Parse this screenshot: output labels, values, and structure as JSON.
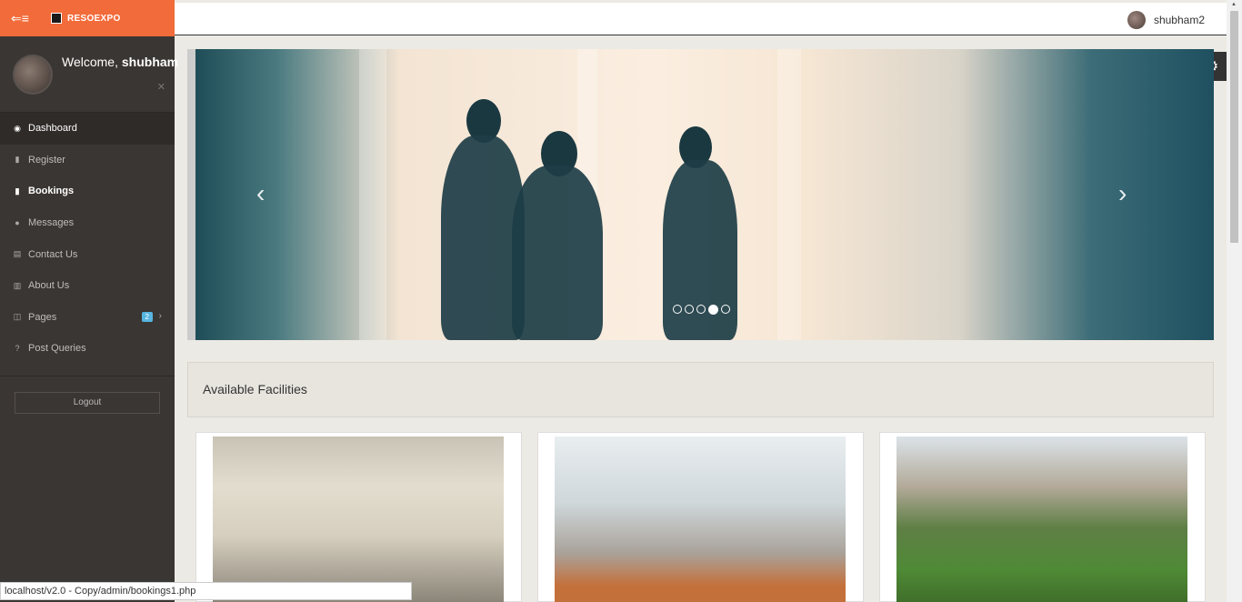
{
  "brand": {
    "name": "RESOEXPO"
  },
  "profile": {
    "welcome_prefix": "Welcome,",
    "username": "shubham"
  },
  "menu": [
    {
      "label": "Dashboard",
      "icon": "dashboard-icon",
      "glyph": "◉"
    },
    {
      "label": "Register",
      "icon": "bookmark-icon",
      "glyph": "▮"
    },
    {
      "label": "Bookings",
      "icon": "bookmark-icon",
      "glyph": "▮"
    },
    {
      "label": "Messages",
      "icon": "info-icon",
      "glyph": "●"
    },
    {
      "label": "Contact Us",
      "icon": "contact-card-icon",
      "glyph": "▤"
    },
    {
      "label": "About Us",
      "icon": "bar-chart-icon",
      "glyph": "▥"
    },
    {
      "label": "Pages",
      "icon": "pages-icon",
      "glyph": "◫",
      "badge": "2"
    },
    {
      "label": "Post Queries",
      "icon": "question-icon",
      "glyph": "?"
    }
  ],
  "logout_label": "Logout",
  "header": {
    "user_name": "shubham2"
  },
  "carousel": {
    "slide_count": 5,
    "active_index": 3
  },
  "facilities": {
    "title": "Available Facilities"
  },
  "status_bar": {
    "url": "localhost/v2.0 - Copy/admin/bookings1.php"
  },
  "colors": {
    "accent": "#f26b3a",
    "sidebar": "#3a3633",
    "badge": "#57b5e0"
  }
}
